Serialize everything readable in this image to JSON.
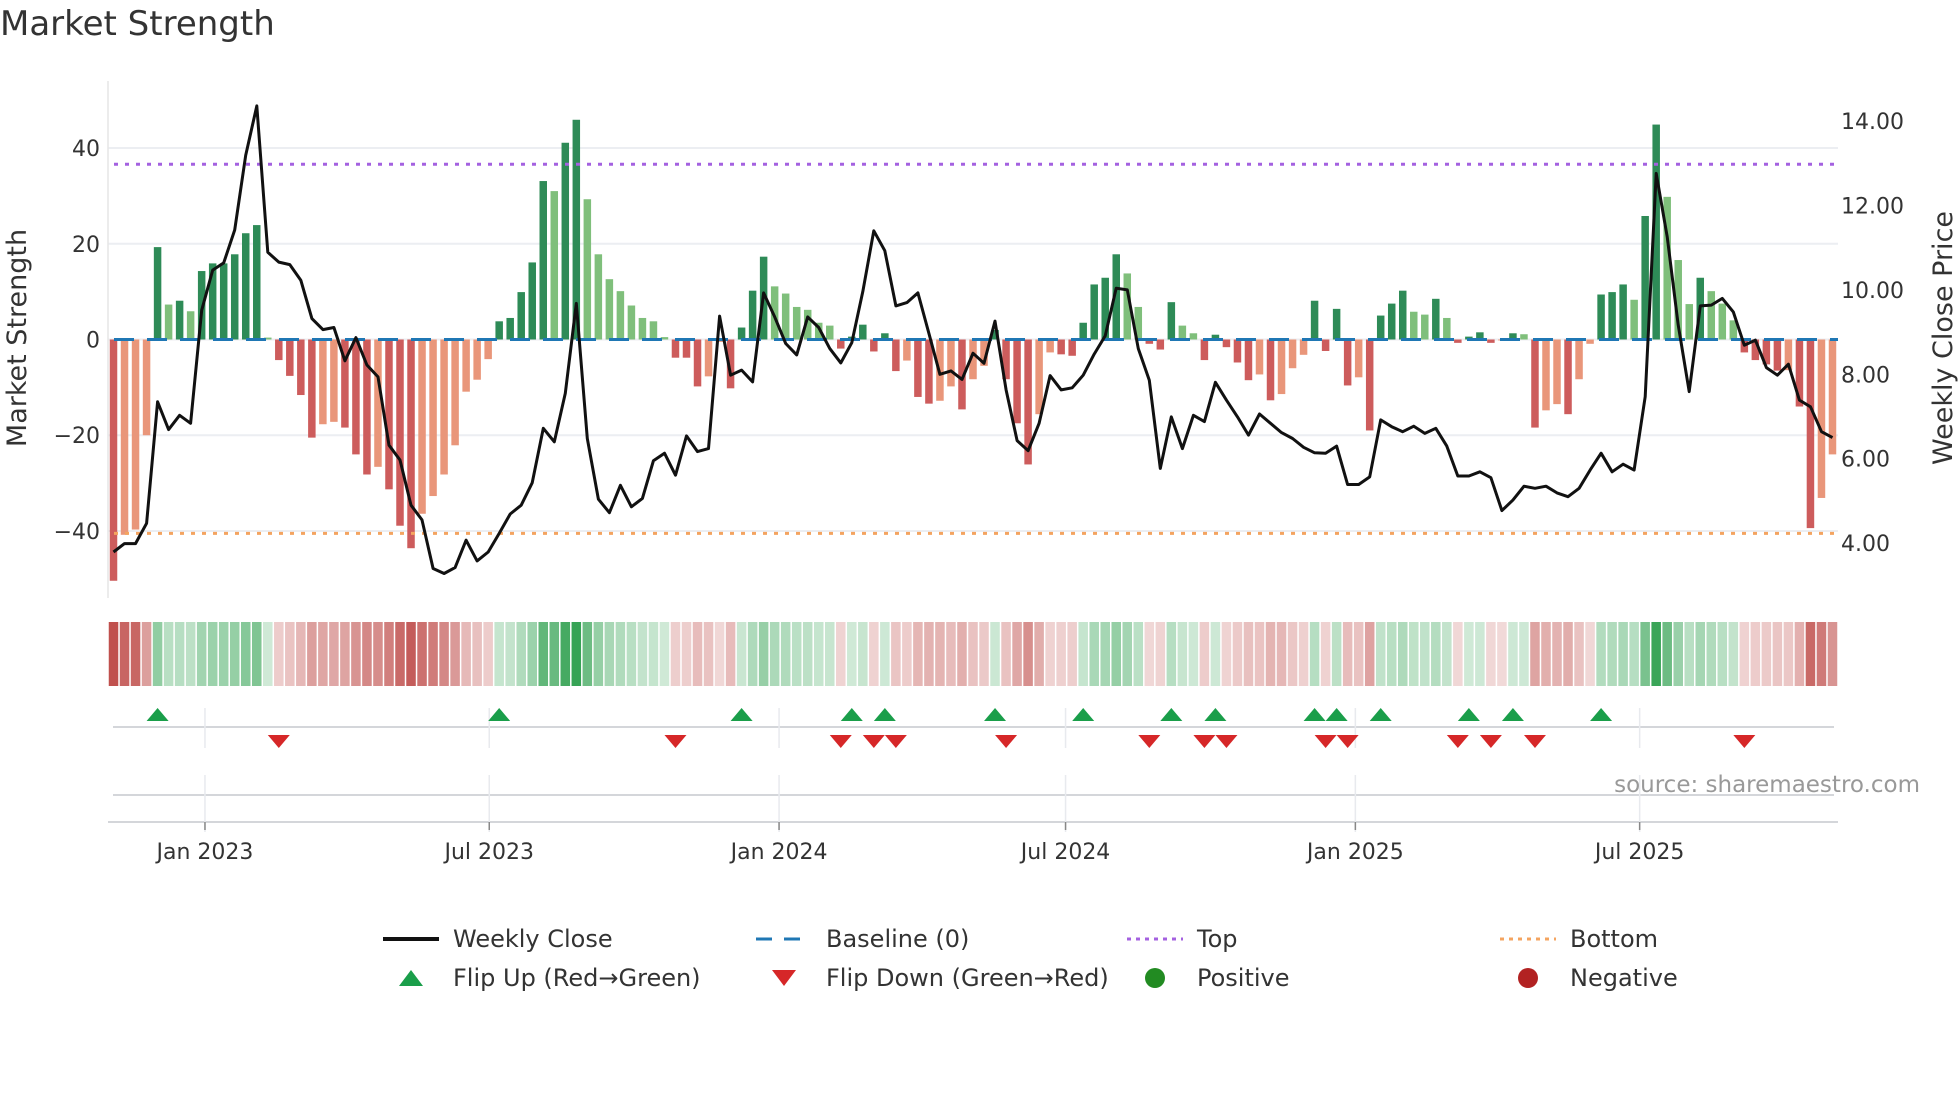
{
  "title": "Market Strength",
  "source": "source: sharemaestro.com",
  "chart_data": {
    "type": "bar",
    "title": "Market Strength",
    "ylabel": "Market Strength",
    "y2label": "Weekly Close Price",
    "ylim": [
      -54,
      54
    ],
    "y2lim": [
      2.7,
      14.95
    ],
    "yticks": [
      -40,
      -20,
      0,
      20,
      40
    ],
    "y2ticks": [
      "4.00",
      "6.00",
      "8.00",
      "10.00",
      "12.00",
      "14.00"
    ],
    "xticks": [
      {
        "label": "Jan 2023",
        "week": 8.3
      },
      {
        "label": "Jul 2023",
        "week": 34.1
      },
      {
        "label": "Jan 2024",
        "week": 60.4
      },
      {
        "label": "Jul 2024",
        "week": 86.4
      },
      {
        "label": "Jan 2025",
        "week": 112.7
      },
      {
        "label": "Jul 2025",
        "week": 138.5
      }
    ],
    "top_level": 36.6,
    "bottom_level": -40.5,
    "baseline": 0,
    "strength": [
      -50.4,
      -40.8,
      -39.7,
      -20,
      19.3,
      7.3,
      8.1,
      5.9,
      14.3,
      15.9,
      15.9,
      17.8,
      22.2,
      23.9,
      0.4,
      -4.3,
      -7.6,
      -11.6,
      -20.5,
      -17.7,
      -17.2,
      -18.4,
      -24,
      -28.2,
      -26.6,
      -31.3,
      -38.9,
      -43.6,
      -36.4,
      -32.7,
      -28.2,
      -22.1,
      -10.9,
      -8.4,
      -4.1,
      3.8,
      4.5,
      9.9,
      16.1,
      33.1,
      31,
      41.1,
      45.9,
      29.3,
      17.8,
      12.6,
      10.1,
      7.1,
      4.5,
      3.8,
      0.5,
      -3.8,
      -3.8,
      -9.8,
      -7.7,
      -0.5,
      -10.2,
      2.5,
      10.2,
      17.3,
      11.1,
      9.6,
      6.8,
      6.2,
      3.5,
      2.9,
      -1.9,
      0.6,
      3.1,
      -2.5,
      1.3,
      -6.6,
      -4.4,
      -12,
      -13.4,
      -12.8,
      -9.8,
      -14.6,
      -8.3,
      -5.5,
      2,
      -8.3,
      -17.5,
      -26.1,
      -15.6,
      -2.7,
      -3.1,
      -3.4,
      3.5,
      11.5,
      12.9,
      17.8,
      13.8,
      6.8,
      -0.9,
      -2.1,
      7.8,
      2.9,
      1.3,
      -4.3,
      1,
      -1.6,
      -4.8,
      -8.5,
      -7.3,
      -12.7,
      -11.4,
      -6,
      -3.2,
      8.1,
      -2.4,
      6.4,
      -9.6,
      -7.9,
      -19,
      5,
      7.5,
      10.2,
      5.8,
      5.2,
      8.5,
      4.5,
      -0.7,
      0.6,
      1.5,
      -0.7,
      -0.2,
      1.3,
      1.1,
      -18.4,
      -14.8,
      -13.5,
      -15.6,
      -8.3,
      -0.9,
      9.4,
      9.9,
      11.5,
      8.3,
      25.8,
      44.9,
      29.8,
      16.6,
      7.4,
      12.9,
      10.1,
      7.5,
      4,
      -2.7,
      -4.3,
      -5.2,
      -6.5,
      -6.4,
      -14,
      -39.4,
      -33.1,
      -24
    ],
    "weekly_close": [
      3.79,
      3.99,
      3.99,
      4.47,
      7.35,
      6.69,
      7.03,
      6.84,
      9.52,
      10.47,
      10.64,
      11.42,
      13.19,
      14.36,
      10.89,
      10.66,
      10.6,
      10.23,
      9.32,
      9.06,
      9.11,
      8.32,
      8.87,
      8.22,
      7.94,
      6.32,
      5.97,
      4.9,
      4.55,
      3.4,
      3.28,
      3.42,
      4.07,
      3.58,
      3.79,
      4.23,
      4.69,
      4.9,
      5.43,
      6.72,
      6.4,
      7.55,
      9.68,
      6.48,
      5.04,
      4.72,
      5.37,
      4.86,
      5.06,
      5.95,
      6.13,
      5.61,
      6.54,
      6.17,
      6.24,
      9.38,
      7.98,
      8.1,
      7.82,
      9.93,
      9.36,
      8.73,
      8.46,
      9.36,
      9.11,
      8.61,
      8.27,
      8.75,
      9.96,
      11.4,
      10.93,
      9.62,
      9.7,
      9.93,
      8.97,
      8.0,
      8.08,
      7.88,
      8.5,
      8.26,
      9.26,
      7.63,
      6.43,
      6.19,
      6.84,
      7.97,
      7.63,
      7.68,
      7.98,
      8.48,
      8.91,
      10.04,
      10.0,
      8.61,
      7.86,
      5.77,
      6.99,
      6.24,
      7.03,
      6.88,
      7.81,
      7.39,
      6.99,
      6.56,
      7.06,
      6.84,
      6.62,
      6.48,
      6.27,
      6.14,
      6.13,
      6.3,
      5.39,
      5.39,
      5.57,
      6.92,
      6.76,
      6.64,
      6.77,
      6.6,
      6.72,
      6.3,
      5.59,
      5.59,
      5.69,
      5.55,
      4.77,
      5.02,
      5.35,
      5.3,
      5.35,
      5.19,
      5.1,
      5.3,
      5.73,
      6.13,
      5.69,
      5.87,
      5.73,
      7.47,
      12.76,
      11.26,
      9.17,
      7.59,
      9.62,
      9.64,
      9.8,
      9.48,
      8.69,
      8.81,
      8.16,
      7.98,
      8.24,
      7.39,
      7.23,
      6.64,
      6.5
    ],
    "flip_up": [
      4,
      35,
      57,
      67,
      70,
      80,
      88,
      96,
      100,
      109,
      111,
      115,
      123,
      127,
      135
    ],
    "flip_down": [
      15,
      51,
      66,
      69,
      71,
      81,
      94,
      99,
      101,
      110,
      112,
      122,
      125,
      129,
      148
    ],
    "legend": [
      {
        "label": "Weekly Close",
        "symbol": "line"
      },
      {
        "label": "Baseline (0)",
        "symbol": "dash"
      },
      {
        "label": "Top",
        "symbol": "dot-purple"
      },
      {
        "label": "Bottom",
        "symbol": "dot-orange"
      },
      {
        "label": "Flip Up (Red→Green)",
        "symbol": "triangle-up"
      },
      {
        "label": "Flip Down (Green→Red)",
        "symbol": "triangle-down"
      },
      {
        "label": "Positive",
        "symbol": "circle-green"
      },
      {
        "label": "Negative",
        "symbol": "circle-red"
      }
    ],
    "legend_position": "bottom-center",
    "colors": {
      "pos_strong": "#2e8b57",
      "pos_weak": "#7fbf7b",
      "neg_strong": "#cd5c5c",
      "neg_weak": "#e9967a",
      "price": "#111111",
      "baseline": "#1f77b4",
      "top": "#a461e0",
      "bottom": "#f4a460",
      "flip_up": "#1a9e4a",
      "flip_down": "#d62728",
      "positive": "#228b22",
      "negative": "#b22222",
      "strip_pos": "#2fa04f",
      "strip_neg": "#c0504d"
    }
  }
}
